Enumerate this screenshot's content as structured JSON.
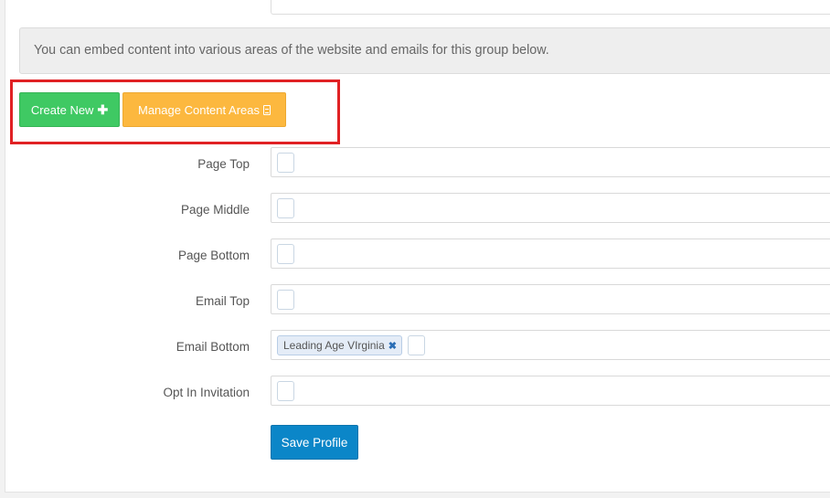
{
  "top_field": {
    "text": "…"
  },
  "info": {
    "message": "You can embed content into various areas of the website and emails for this group below."
  },
  "buttons": {
    "create_new": "Create New",
    "create_new_icon": "plus-icon",
    "manage_content_areas": "Manage Content Areas",
    "manage_content_areas_icon": "document-icon",
    "save_profile": "Save Profile"
  },
  "rows": [
    {
      "label": "Page Top",
      "tags": []
    },
    {
      "label": "Page Middle",
      "tags": []
    },
    {
      "label": "Page Bottom",
      "tags": []
    },
    {
      "label": "Email Top",
      "tags": []
    },
    {
      "label": "Email Bottom",
      "tags": [
        "Leading Age VIrginia"
      ],
      "remove_glyph": "✖"
    },
    {
      "label": "Opt In Invitation",
      "tags": []
    }
  ],
  "colors": {
    "create_button": "#3fc963",
    "manage_button": "#fcb83f",
    "save_button": "#0b86c8",
    "highlight_border": "#e02124"
  }
}
